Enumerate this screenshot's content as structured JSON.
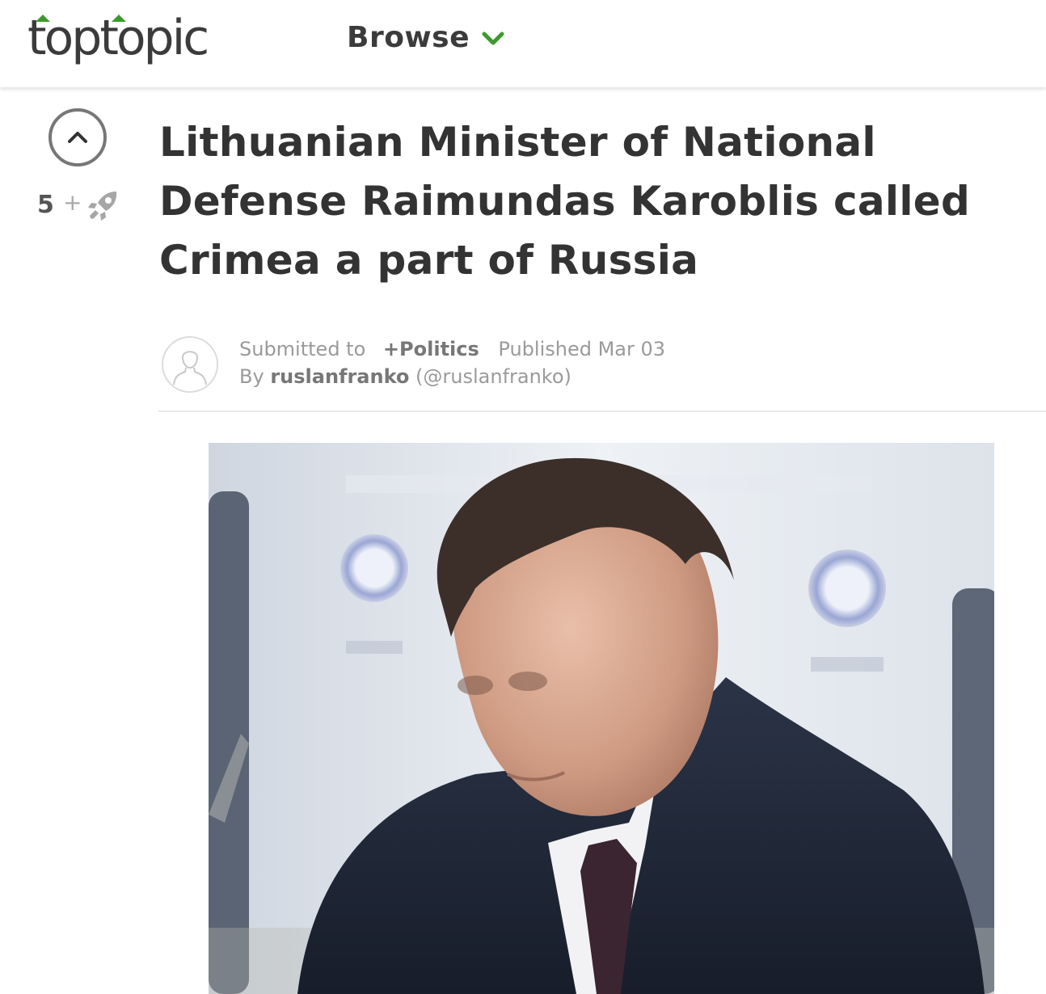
{
  "header": {
    "logo_text": "toptopic",
    "browse_label": "Browse",
    "chevron_icon": "chevron-down-icon",
    "accent_color": "#3c9a2d"
  },
  "post": {
    "vote_count": "5",
    "vote_plus": "+",
    "upvote_icon": "chevron-up-icon",
    "boost_icon": "rocket-icon",
    "title": "Lithuanian Minister of National Defense Raimundas Karoblis called Crimea a part of Russia",
    "meta": {
      "submitted_to_label": "Submitted to",
      "category": "+Politics",
      "published": "Published Mar 03",
      "by_label": "By",
      "username": "ruslanfranko",
      "handle": "(@ruslanfranko)"
    },
    "image_alt": "Photo of a man in a dark suit seated at a conference table with microphones"
  }
}
